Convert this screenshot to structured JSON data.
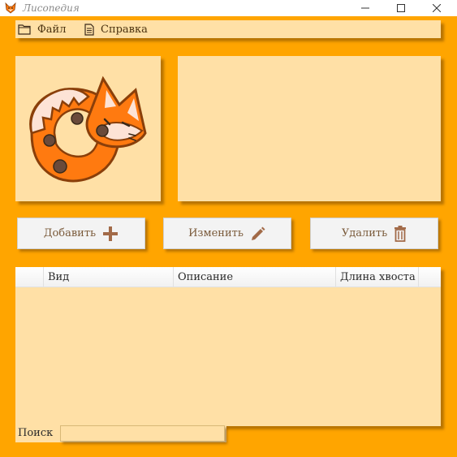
{
  "window": {
    "title": "Лисопедия",
    "icons": [
      "fox-app-icon",
      "minimize-icon",
      "maximize-icon",
      "close-icon"
    ]
  },
  "menu": {
    "file_label": "Файл",
    "help_label": "Справка",
    "icons": [
      "folder-icon",
      "document-icon"
    ]
  },
  "buttons": {
    "add_label": "Добавить",
    "edit_label": "Изменить",
    "delete_label": "Удалить",
    "icons": [
      "plus-icon",
      "pencil-icon",
      "trash-icon"
    ]
  },
  "table": {
    "columns": [
      "Вид",
      "Описание",
      "Длина хвоста"
    ],
    "rows": []
  },
  "search": {
    "label": "Поиск",
    "value": ""
  },
  "colors": {
    "background": "#ffa500",
    "panel": "#ffe0a6",
    "fox_orange": "#ff7a10",
    "fox_outline": "#8a3f0a"
  }
}
